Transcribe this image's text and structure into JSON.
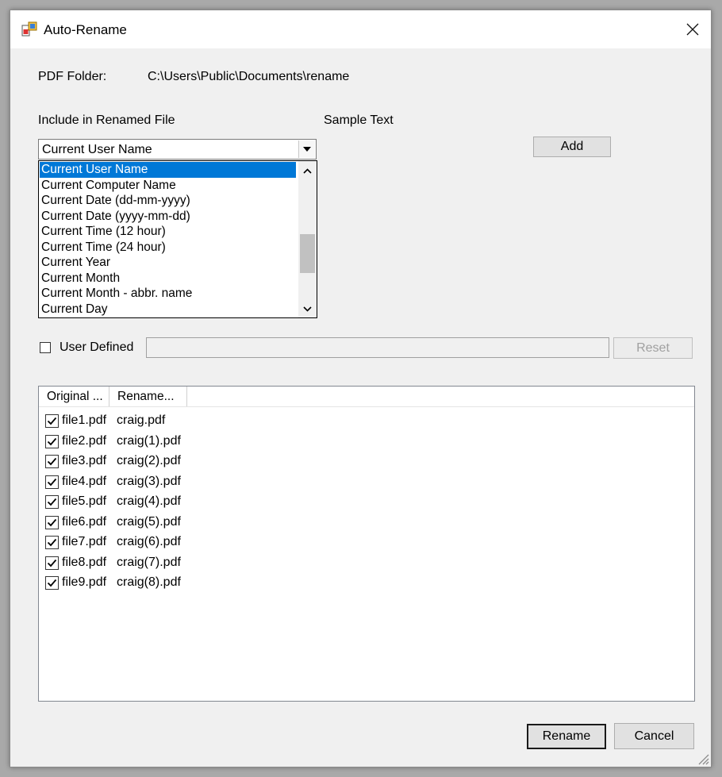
{
  "window": {
    "title": "Auto-Rename"
  },
  "folder": {
    "label": "PDF Folder:",
    "path": "C:\\Users\\Public\\Documents\\rename"
  },
  "include": {
    "label": "Include in Renamed File",
    "selected": "Current User Name",
    "options": [
      "Current User Name",
      "Current Computer Name",
      "Current Date (dd-mm-yyyy)",
      "Current Date (yyyy-mm-dd)",
      "Current Time (12 hour)",
      "Current Time (24 hour)",
      "Current Year",
      "Current Month",
      "Current Month - abbr. name",
      "Current Day"
    ]
  },
  "sample": {
    "label": "Sample Text"
  },
  "buttons": {
    "add": "Add",
    "reset": "Reset",
    "rename": "Rename",
    "cancel": "Cancel"
  },
  "user_defined": {
    "label": "User Defined",
    "checked": false,
    "value": ""
  },
  "files": {
    "columns": [
      "Original ...",
      "Rename..."
    ],
    "rows": [
      {
        "original": "file1.pdf",
        "renamed": "craig.pdf",
        "checked": true
      },
      {
        "original": "file2.pdf",
        "renamed": "craig(1).pdf",
        "checked": true
      },
      {
        "original": "file3.pdf",
        "renamed": "craig(2).pdf",
        "checked": true
      },
      {
        "original": "file4.pdf",
        "renamed": "craig(3).pdf",
        "checked": true
      },
      {
        "original": "file5.pdf",
        "renamed": "craig(4).pdf",
        "checked": true
      },
      {
        "original": "file6.pdf",
        "renamed": "craig(5).pdf",
        "checked": true
      },
      {
        "original": "file7.pdf",
        "renamed": "craig(6).pdf",
        "checked": true
      },
      {
        "original": "file8.pdf",
        "renamed": "craig(7).pdf",
        "checked": true
      },
      {
        "original": "file9.pdf",
        "renamed": "craig(8).pdf",
        "checked": true
      }
    ]
  },
  "colors": {
    "selection": "#0078d7",
    "window_bg": "#f0f0f0"
  }
}
